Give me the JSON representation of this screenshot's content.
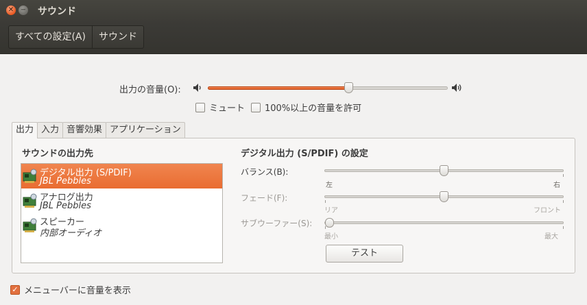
{
  "window": {
    "title": "サウンド"
  },
  "breadcrumb": {
    "all_settings": "すべての設定(A)",
    "current": "サウンド"
  },
  "output_volume": {
    "label": "出力の音量(O):",
    "level_percent": 59
  },
  "mute": {
    "label": "ミュート",
    "checked": false
  },
  "allow_over_100": {
    "label": "100%以上の音量を許可",
    "checked": false
  },
  "tabs": [
    {
      "label": "出力",
      "active": true
    },
    {
      "label": "入力",
      "active": false
    },
    {
      "label": "音響効果",
      "active": false
    },
    {
      "label": "アプリケーション",
      "active": false
    }
  ],
  "output_panel": {
    "devices_title": "サウンドの出力先",
    "devices": [
      {
        "name": "デジタル出力 (S/PDIF)",
        "sub": "JBL Pebbles",
        "selected": true
      },
      {
        "name": "アナログ出力",
        "sub": "JBL Pebbles",
        "selected": false
      },
      {
        "name": "スピーカー",
        "sub": "内部オーディオ",
        "selected": false
      }
    ],
    "settings_title": "デジタル出力 (S/PDIF) の設定",
    "balance": {
      "label": "バランス(B):",
      "left": "左",
      "right": "右",
      "position_percent": 50
    },
    "fade": {
      "label": "フェード(F):",
      "left": "リア",
      "right": "フロント",
      "position_percent": 50
    },
    "subwoofer": {
      "label": "サブウーファー(S):",
      "left": "最小",
      "right": "最大",
      "position_percent": 0
    },
    "test_button": "テスト"
  },
  "menubar_checkbox": {
    "label": "メニューバーに音量を表示",
    "checked": true
  },
  "colors": {
    "accent": "#e96c31",
    "titlebar": "#3c3b37"
  }
}
